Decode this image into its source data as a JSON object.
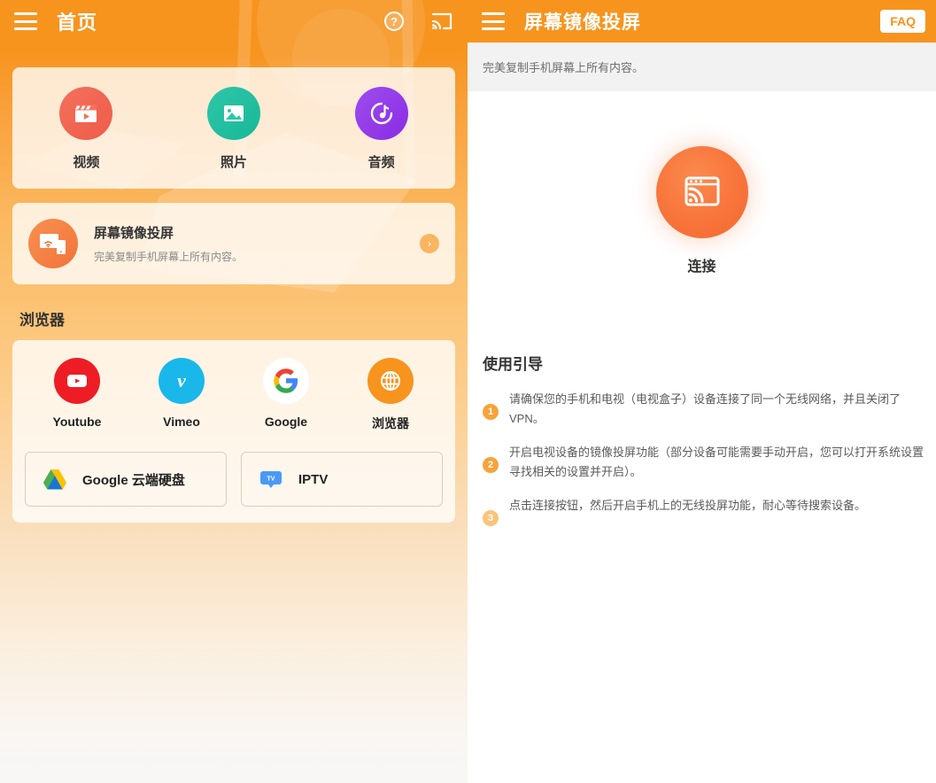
{
  "left": {
    "topbar": {
      "menu_icon": "hamburger-menu-icon",
      "title": "首页",
      "help_icon": "?",
      "cast_icon": "cast-icon"
    },
    "media": {
      "items": [
        {
          "label": "视频",
          "icon": "video-clapper-icon",
          "color": "#ee5c49"
        },
        {
          "label": "照片",
          "icon": "photo-image-icon",
          "color": "#17b898"
        },
        {
          "label": "音频",
          "icon": "music-note-icon",
          "color": "#8a2be2"
        }
      ]
    },
    "mirror_card": {
      "icon": "screen-mirror-icon",
      "title": "屏幕镜像投屏",
      "subtitle": "完美复制手机屏幕上所有内容。",
      "arrow": "›"
    },
    "browser_section": {
      "title": "浏览器",
      "items": [
        {
          "label": "Youtube",
          "icon": "youtube-icon",
          "color": "#ee1d25"
        },
        {
          "label": "Vimeo",
          "icon": "vimeo-icon",
          "color": "#1ab7ea"
        },
        {
          "label": "Google",
          "icon": "google-icon",
          "color": "#ffffff"
        },
        {
          "label": "浏览器",
          "icon": "globe-icon",
          "color": "#f7941e"
        }
      ],
      "pills": [
        {
          "label": "Google 云端硬盘",
          "icon": "google-drive-icon"
        },
        {
          "label": "IPTV",
          "icon": "tv-icon"
        }
      ]
    }
  },
  "right": {
    "topbar": {
      "menu_icon": "hamburger-menu-icon",
      "title": "屏幕镜像投屏",
      "faq_label": "FAQ"
    },
    "subtitle": "完美复制手机屏幕上所有内容。",
    "connect": {
      "icon": "cast-screen-icon",
      "label": "连接"
    },
    "guide": {
      "title": "使用引导",
      "steps": [
        {
          "number": "1",
          "text": "请确保您的手机和电视（电视盒子）设备连接了同一个无线网络，并且关闭了VPN。"
        },
        {
          "number": "2",
          "text": "开启电视设备的镜像投屏功能（部分设备可能需要手动开启，您可以打开系统设置寻找相关的设置并开启）。"
        },
        {
          "number": "3",
          "text": "点击连接按钮，然后开启手机上的无线投屏功能，耐心等待搜索设备。"
        }
      ]
    }
  },
  "colors": {
    "brand_orange": "#f7941e",
    "connect_orange": "#f8743a",
    "card_bg": "rgba(255,255,255,0.78)"
  }
}
